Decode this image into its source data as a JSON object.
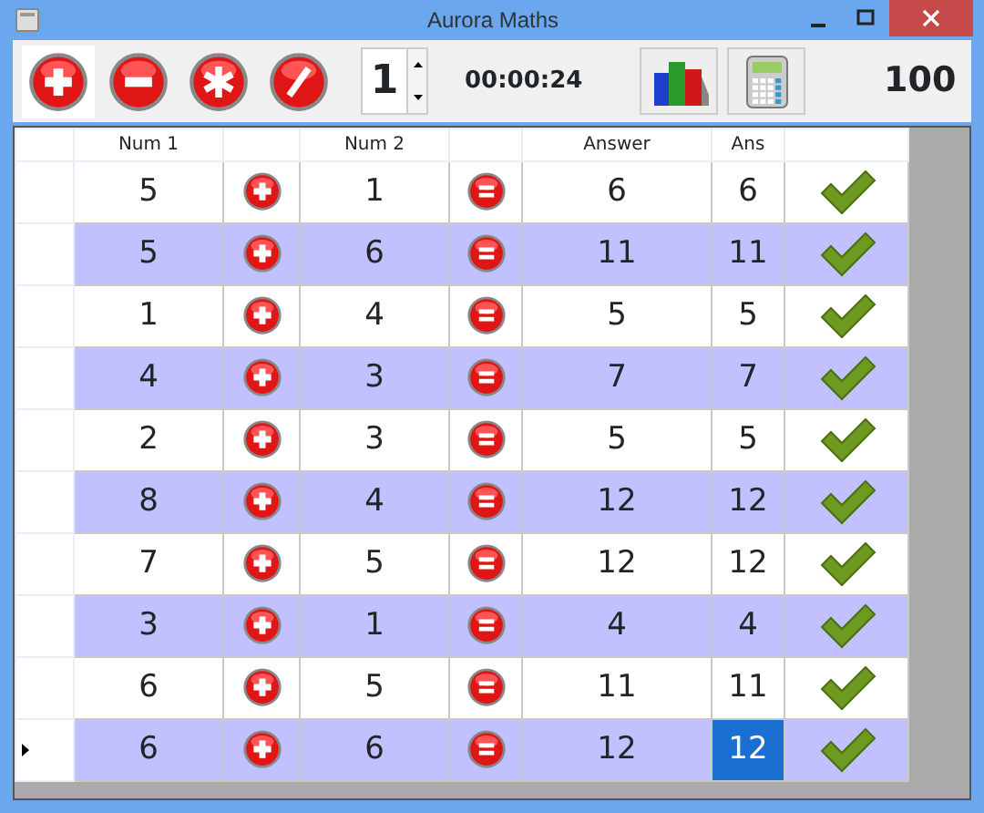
{
  "window": {
    "title": "Aurora Maths"
  },
  "toolbar": {
    "operations": [
      {
        "kind": "plus",
        "selected": true
      },
      {
        "kind": "minus",
        "selected": false
      },
      {
        "kind": "times",
        "selected": false
      },
      {
        "kind": "divide",
        "selected": false
      }
    ],
    "level_spinner": {
      "value": "1"
    },
    "timer": "00:00:24",
    "score": "100"
  },
  "table": {
    "columns": [
      "Num 1",
      "Num 2",
      "Answer",
      "Ans"
    ],
    "rows": [
      {
        "num_1": "5",
        "num_2": "1",
        "answer": "6",
        "ans": "6",
        "correct": true,
        "current": false,
        "ans_selected": false
      },
      {
        "num_1": "5",
        "num_2": "6",
        "answer": "11",
        "ans": "11",
        "correct": true,
        "current": false,
        "ans_selected": false
      },
      {
        "num_1": "1",
        "num_2": "4",
        "answer": "5",
        "ans": "5",
        "correct": true,
        "current": false,
        "ans_selected": false
      },
      {
        "num_1": "4",
        "num_2": "3",
        "answer": "7",
        "ans": "7",
        "correct": true,
        "current": false,
        "ans_selected": false
      },
      {
        "num_1": "2",
        "num_2": "3",
        "answer": "5",
        "ans": "5",
        "correct": true,
        "current": false,
        "ans_selected": false
      },
      {
        "num_1": "8",
        "num_2": "4",
        "answer": "12",
        "ans": "12",
        "correct": true,
        "current": false,
        "ans_selected": false
      },
      {
        "num_1": "7",
        "num_2": "5",
        "answer": "12",
        "ans": "12",
        "correct": true,
        "current": false,
        "ans_selected": false
      },
      {
        "num_1": "3",
        "num_2": "1",
        "answer": "4",
        "ans": "4",
        "correct": true,
        "current": false,
        "ans_selected": false
      },
      {
        "num_1": "6",
        "num_2": "5",
        "answer": "11",
        "ans": "11",
        "correct": true,
        "current": false,
        "ans_selected": false
      },
      {
        "num_1": "6",
        "num_2": "6",
        "answer": "12",
        "ans": "12",
        "correct": true,
        "current": true,
        "ans_selected": true
      }
    ]
  }
}
